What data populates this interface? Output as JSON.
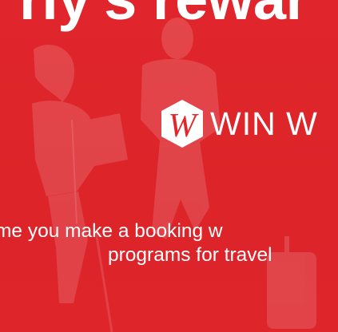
{
  "banner": {
    "headline": "rly's rewar",
    "logo_text": "WIN W",
    "logo_mark_letter": "W",
    "tagline_line1": "me you make a booking w",
    "tagline_line2": "programs for travel"
  },
  "colors": {
    "background": "#e2262b",
    "text": "#ffffff"
  }
}
